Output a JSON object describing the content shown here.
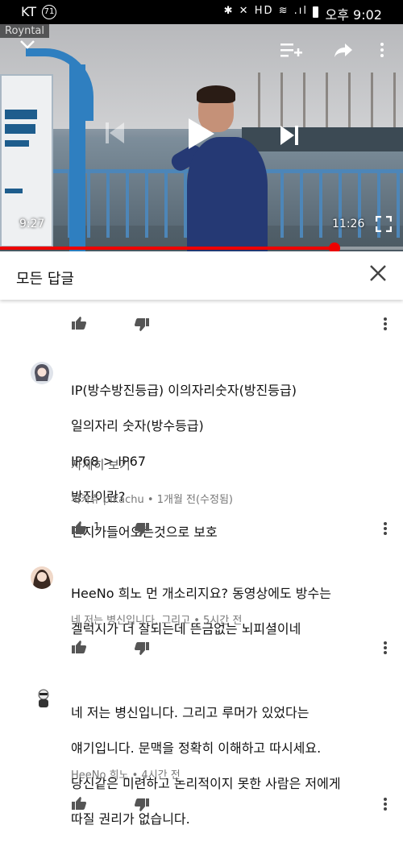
{
  "status_bar": {
    "carrier": "KT",
    "badge": "71",
    "time": "오후 9:02",
    "icons": "✱ ✕ HD ≋ .ıl"
  },
  "watermark": "Royntal",
  "video": {
    "elapsed": "9:27",
    "duration": "11:26",
    "progress": 0.83
  },
  "header": {
    "title": "모든 답글"
  },
  "comments": [
    {
      "lines": [
        "IP(방수방진등급)  이의자리숫자(방진등급)",
        "일의자리 숫자(방수등급)",
        "IP68 > IP67",
        "방진이란?",
        "먼지가들어오는것으로 보호"
      ],
      "show_more": "자세히 보기",
      "meta": "피카츄 pikachu • 1개월 전(수정됨)",
      "likes": "1"
    },
    {
      "lines": [
        "HeeNo 희노 먼 개소리지요? 동영상에도 방수는",
        "겔럭시가 더 잘되는데 뜬금없는 뇌피셜이네"
      ],
      "meta": "네 저는 병신입니다. 그리고 • 5시간 전"
    },
    {
      "lines": [
        "네 저는 병신입니다. 그리고  루머가 있었다는",
        "얘기입니다. 문맥을 정확히 이해하고 따시세요.",
        "당신같은 미련하고 논리적이지 못한 사람은 저에게",
        "따질 권리가 없습니다."
      ],
      "meta": "HeeNo 희노 • 4시간 전"
    }
  ],
  "colors": {
    "accent": "#e00000",
    "pillar": "#2f7fc0",
    "shirt": "#253974"
  }
}
